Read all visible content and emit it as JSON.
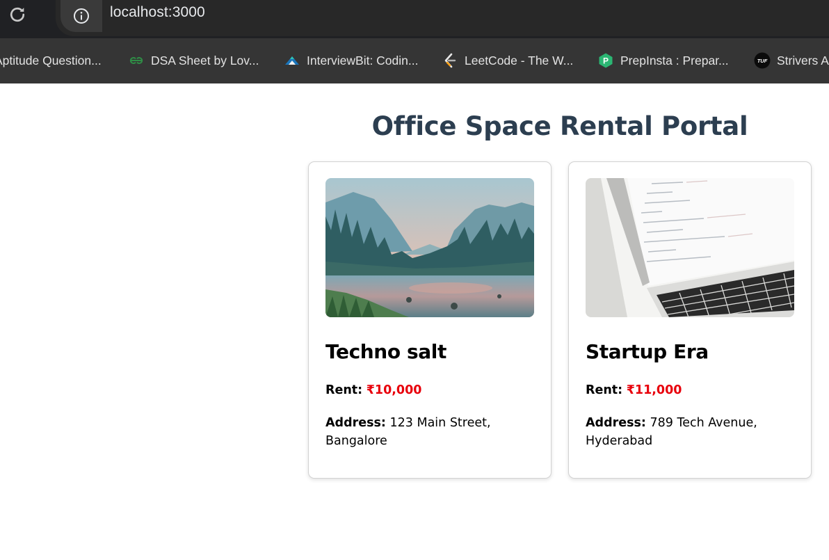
{
  "browser": {
    "url": "localhost:3000",
    "bookmarks": [
      {
        "label": "Aptitude Question...",
        "icon": "none"
      },
      {
        "label": "DSA Sheet by Lov...",
        "icon": "geeksforgeeks-icon"
      },
      {
        "label": "InterviewBit: Codin...",
        "icon": "interviewbit-icon"
      },
      {
        "label": "LeetCode - The W...",
        "icon": "leetcode-icon"
      },
      {
        "label": "PrepInsta : Prepar...",
        "icon": "prepinsta-icon"
      },
      {
        "label": "Strivers A",
        "icon": "tuf-icon"
      }
    ],
    "tuf_badge": "TUF",
    "prepinsta_badge": "P"
  },
  "page": {
    "title": "Office Space Rental Portal"
  },
  "offices": [
    {
      "name": "Techno salt",
      "rent_label": "Rent:",
      "rent": "₹10,000",
      "address_label": "Address:",
      "address": "123 Main Street, Bangalore",
      "image": "mountain-lake-landscape"
    },
    {
      "name": "Startup Era",
      "rent_label": "Rent:",
      "rent": "₹11,000",
      "address_label": "Address:",
      "address": "789 Tech Avenue, Hyderabad",
      "image": "laptop-with-code"
    }
  ],
  "colors": {
    "title": "#2c3e50",
    "price": "#e8000b",
    "chrome_dark": "#202124",
    "bookmarks_bar": "#353535"
  }
}
